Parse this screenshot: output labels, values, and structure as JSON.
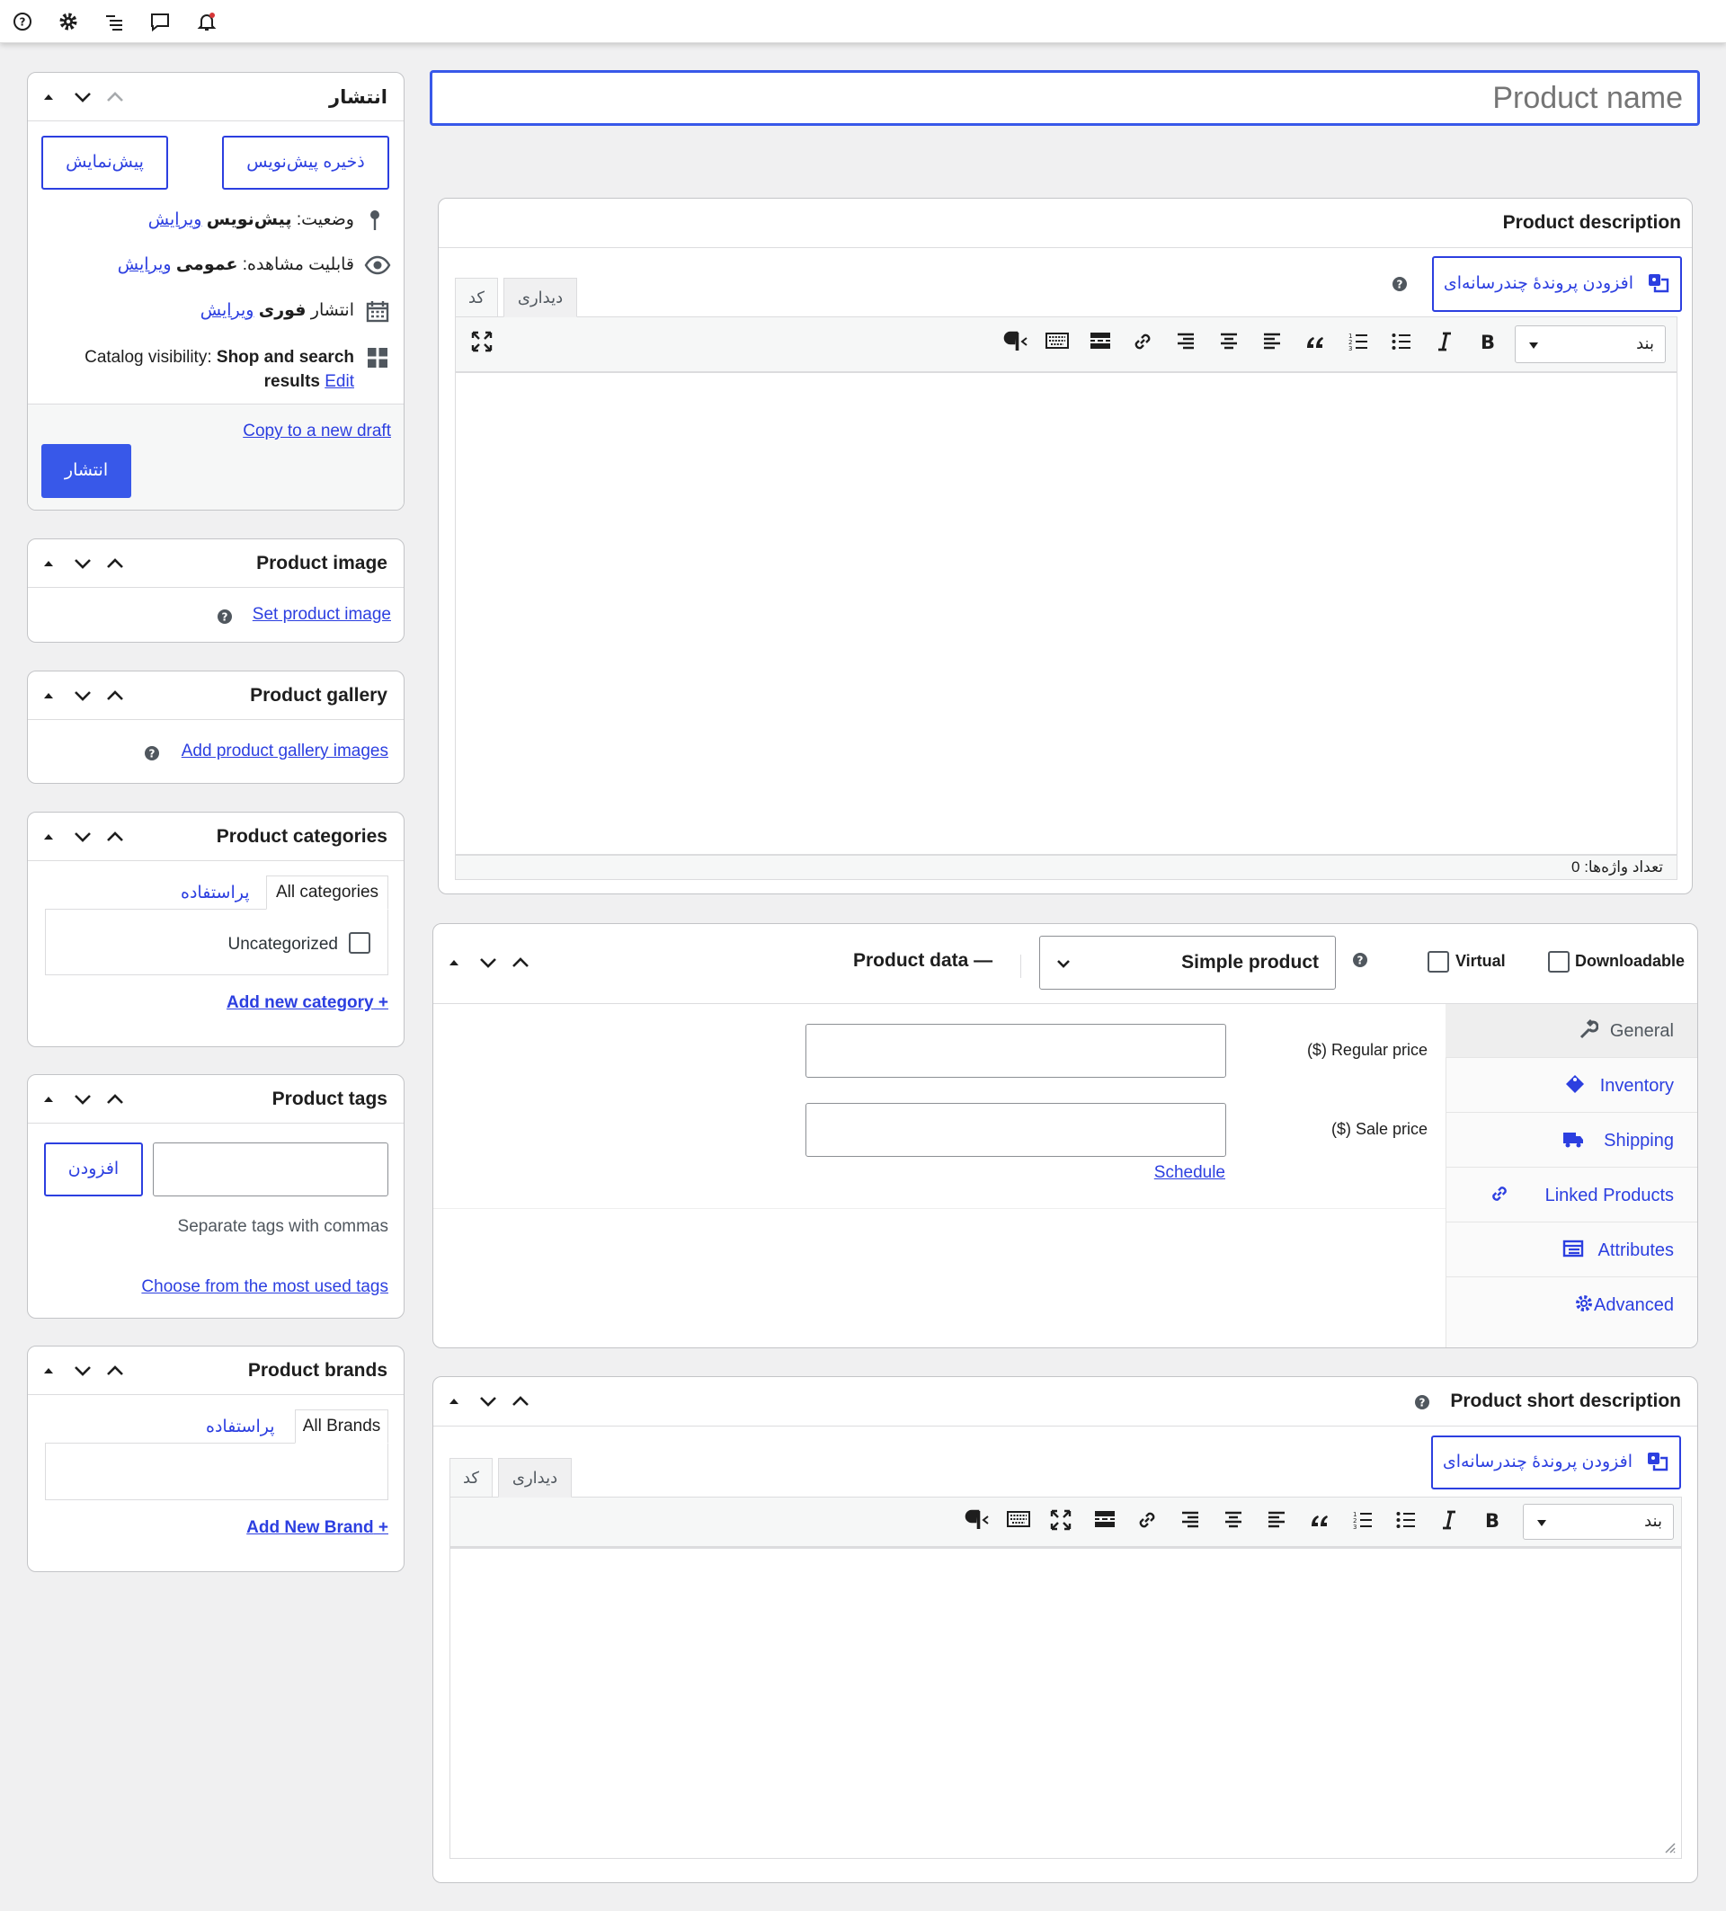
{
  "topbar": {
    "icons": [
      "help-icon",
      "gear-icon",
      "list-icon",
      "comment-icon",
      "bell-icon"
    ]
  },
  "title_field": {
    "placeholder": "Product name"
  },
  "publish": {
    "title": "انتشار",
    "save_draft": "ذخیره پیش‌نویس",
    "preview": "پیش‌نمایش",
    "status_label": "وضعیت:",
    "status_value": "پیش‌نویس",
    "visibility_label": "قابلیت مشاهده:",
    "visibility_value": "عمومی",
    "publish_label": "انتشار",
    "publish_value": "فوری",
    "edit": "ویرایش",
    "catalog_label": "Catalog visibility:",
    "catalog_value_1": "Shop and search",
    "catalog_value_2": "results",
    "catalog_edit": "Edit",
    "copy_draft": "Copy to a new draft",
    "publish_button": "انتشار"
  },
  "product_image": {
    "title": "Product image",
    "link": "Set product image"
  },
  "product_gallery": {
    "title": "Product gallery",
    "link": "Add product gallery images"
  },
  "categories": {
    "title": "Product categories",
    "tab_all": "All categories",
    "tab_used": "پراستفاده",
    "item": "Uncategorized",
    "add": "+ Add new category"
  },
  "tags": {
    "title": "Product tags",
    "add_button": "افزودن",
    "hint": "Separate tags with commas",
    "choose": "Choose from the most used tags"
  },
  "brands": {
    "title": "Product brands",
    "tab_all": "All Brands",
    "tab_used": "پراستفاده",
    "add": "+ Add New Brand"
  },
  "description": {
    "title": "Product description",
    "add_media": "افزودن پروندهٔ چندرسانه‌ای",
    "tab_visual": "دیداری",
    "tab_code": "کد",
    "format": "بند",
    "word_count": "تعداد واژه‌ها: 0"
  },
  "product_data": {
    "title": "Product data —",
    "type": "Simple product",
    "virtual": "Virtual",
    "downloadable": "Downloadable",
    "regular_price": "($) Regular price",
    "sale_price": "($) Sale price",
    "schedule": "Schedule",
    "tabs": [
      {
        "label": "General",
        "icon": "wrench-icon"
      },
      {
        "label": "Inventory",
        "icon": "tag-icon"
      },
      {
        "label": "Shipping",
        "icon": "truck-icon"
      },
      {
        "label": "Linked Products",
        "icon": "link-icon"
      },
      {
        "label": "Attributes",
        "icon": "table-icon"
      },
      {
        "label": "Advanced",
        "icon": "gear-icon"
      }
    ]
  },
  "short_description": {
    "title": "Product short description",
    "add_media": "افزودن پروندهٔ چندرسانه‌ای",
    "tab_visual": "دیداری",
    "tab_code": "کد",
    "format": "بند"
  },
  "colors": {
    "accent": "#2c3fe0",
    "publish_bg": "#3858e9",
    "border": "#c3c4c7",
    "text": "#1e1e1e"
  }
}
